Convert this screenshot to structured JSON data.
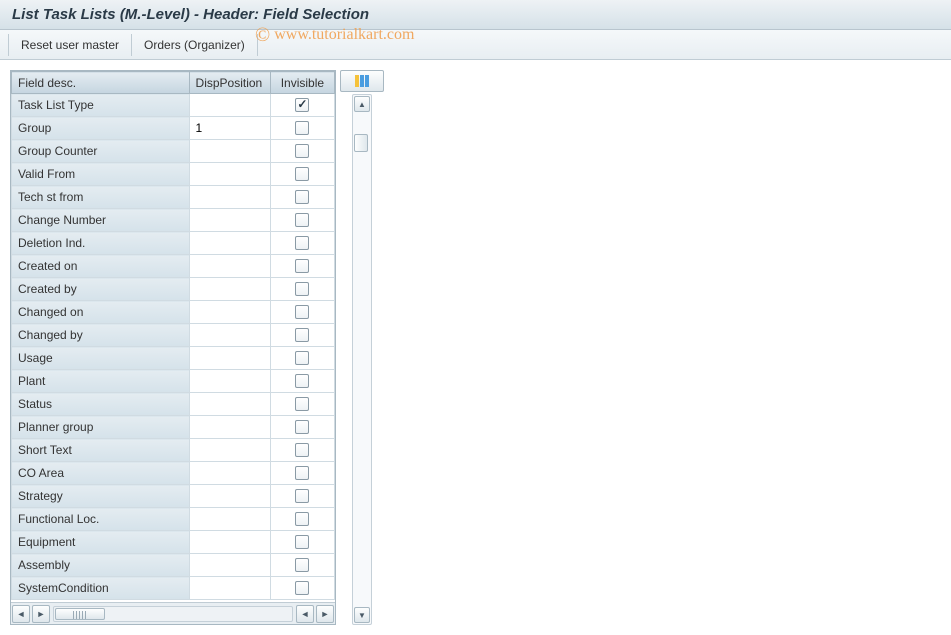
{
  "header": {
    "title": "List Task Lists (M.-Level) - Header: Field Selection"
  },
  "toolbar": {
    "reset_label": "Reset user master",
    "orders_label": "Orders (Organizer)"
  },
  "watermark": {
    "copy_symbol": "©",
    "text": "www.tutorialkart.com"
  },
  "table": {
    "columns": {
      "field_desc": "Field desc.",
      "disp_position": "DispPosition",
      "invisible": "Invisible"
    },
    "rows": [
      {
        "field_desc": "Task List Type",
        "disp_position": "",
        "invisible": true
      },
      {
        "field_desc": "Group",
        "disp_position": "1",
        "invisible": false
      },
      {
        "field_desc": "Group Counter",
        "disp_position": "",
        "invisible": false
      },
      {
        "field_desc": "Valid From",
        "disp_position": "",
        "invisible": false
      },
      {
        "field_desc": "Tech st from",
        "disp_position": "",
        "invisible": false
      },
      {
        "field_desc": "Change Number",
        "disp_position": "",
        "invisible": false
      },
      {
        "field_desc": "Deletion Ind.",
        "disp_position": "",
        "invisible": false
      },
      {
        "field_desc": "Created on",
        "disp_position": "",
        "invisible": false
      },
      {
        "field_desc": "Created by",
        "disp_position": "",
        "invisible": false
      },
      {
        "field_desc": "Changed on",
        "disp_position": "",
        "invisible": false
      },
      {
        "field_desc": "Changed by",
        "disp_position": "",
        "invisible": false
      },
      {
        "field_desc": "Usage",
        "disp_position": "",
        "invisible": false
      },
      {
        "field_desc": "Plant",
        "disp_position": "",
        "invisible": false
      },
      {
        "field_desc": "Status",
        "disp_position": "",
        "invisible": false
      },
      {
        "field_desc": "Planner group",
        "disp_position": "",
        "invisible": false
      },
      {
        "field_desc": "Short Text",
        "disp_position": "",
        "invisible": false
      },
      {
        "field_desc": "CO Area",
        "disp_position": "",
        "invisible": false
      },
      {
        "field_desc": "Strategy",
        "disp_position": "",
        "invisible": false
      },
      {
        "field_desc": "Functional Loc.",
        "disp_position": "",
        "invisible": false
      },
      {
        "field_desc": "Equipment",
        "disp_position": "",
        "invisible": false
      },
      {
        "field_desc": "Assembly",
        "disp_position": "",
        "invisible": false
      },
      {
        "field_desc": "SystemCondition",
        "disp_position": "",
        "invisible": false
      }
    ]
  }
}
